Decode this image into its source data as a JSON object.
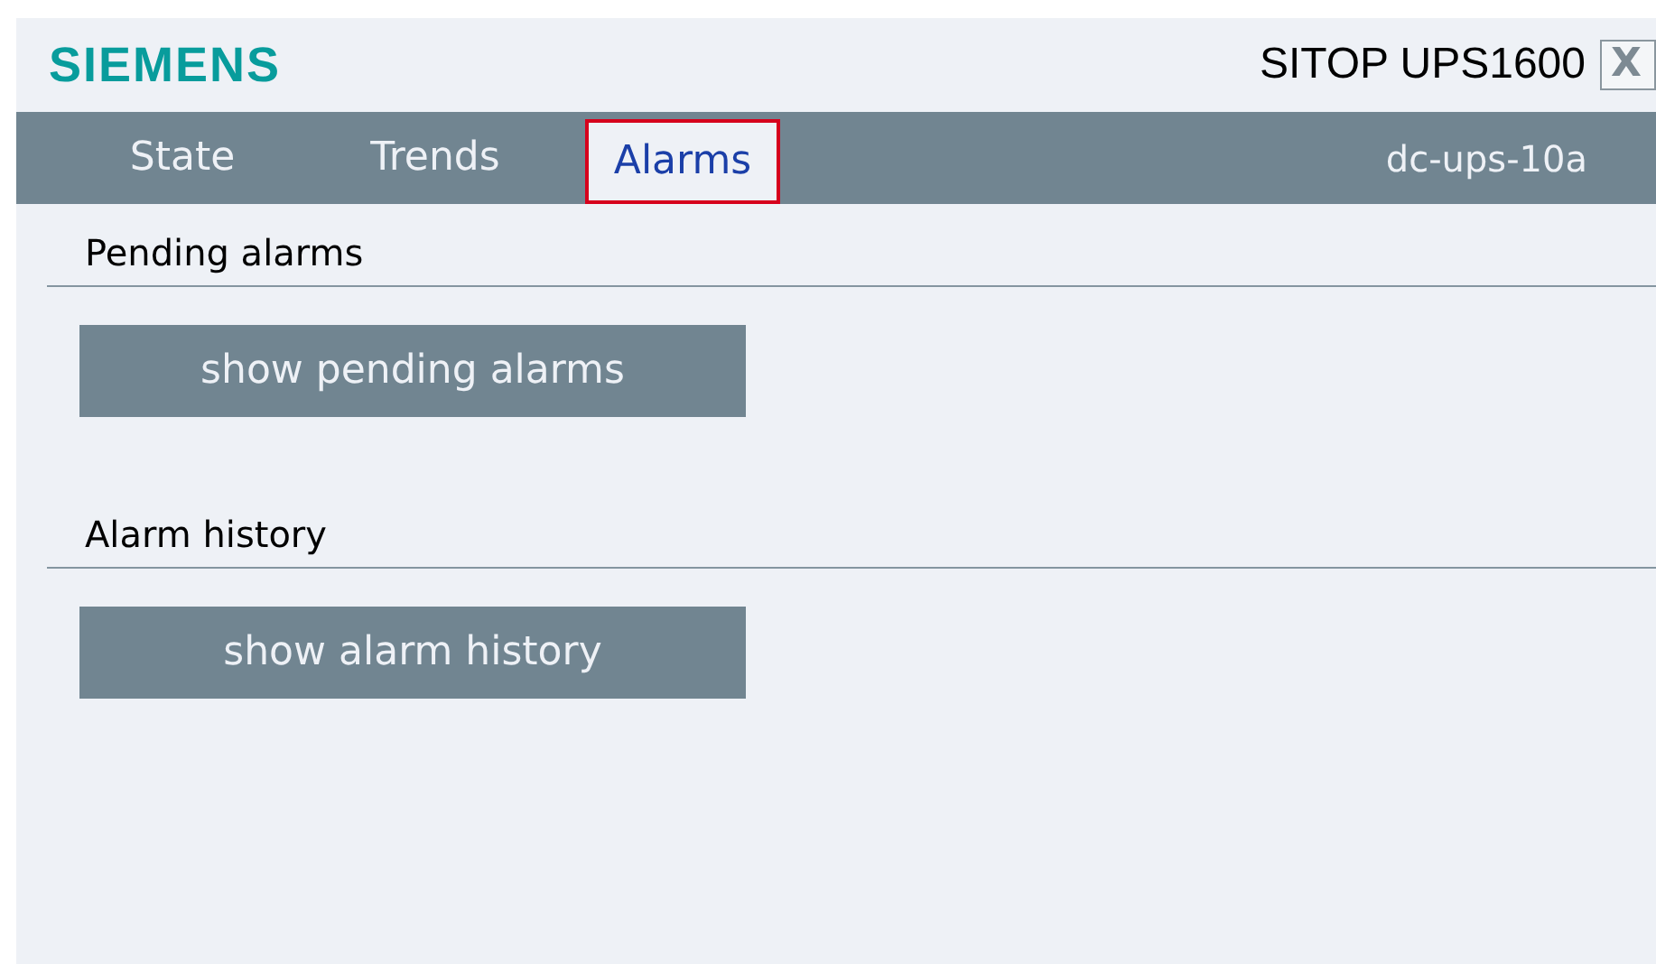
{
  "header": {
    "logo": "SIEMENS",
    "title": "SITOP UPS1600",
    "close": "X"
  },
  "tabs": [
    {
      "label": "State",
      "selected": false
    },
    {
      "label": "Trends",
      "selected": false
    },
    {
      "label": "Alarms",
      "selected": true
    }
  ],
  "device_name": "dc-ups-10a",
  "sections": [
    {
      "heading": "Pending alarms",
      "button": "show pending alarms"
    },
    {
      "heading": "Alarm history",
      "button": "show alarm history"
    }
  ]
}
